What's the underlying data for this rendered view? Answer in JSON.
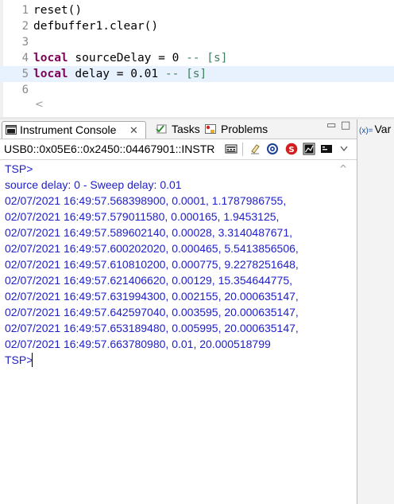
{
  "editor": {
    "lines": [
      {
        "num": "1",
        "parts": [
          {
            "t": "reset()",
            "c": "plain"
          }
        ]
      },
      {
        "num": "2",
        "parts": [
          {
            "t": "defbuffer1.clear()",
            "c": "plain"
          }
        ]
      },
      {
        "num": "3",
        "parts": []
      },
      {
        "num": "4",
        "parts": [
          {
            "t": "local",
            "c": "kw"
          },
          {
            "t": " sourceDelay = 0 ",
            "c": "plain"
          },
          {
            "t": "-- [s]",
            "c": "cm"
          }
        ]
      },
      {
        "num": "5",
        "parts": [
          {
            "t": "local",
            "c": "kw"
          },
          {
            "t": " delay = 0.01 ",
            "c": "plain"
          },
          {
            "t": "-- [s]",
            "c": "cm"
          }
        ]
      },
      {
        "num": "6",
        "parts": []
      }
    ],
    "current_line": 5,
    "scroll_left_glyph": "<"
  },
  "tabs": {
    "console_label": "Instrument Console",
    "close_glyph": "✕",
    "tasks_label": "Tasks",
    "problems_label": "Problems",
    "minimize_glyph": "▭",
    "maximize_glyph": "□",
    "variables_label": "Var",
    "variables_prefix": "(x)="
  },
  "toolbar": {
    "connection": "USB0::0x05E6::0x2450::04467901::INSTR",
    "icons": [
      "keypad-icon",
      "eraser-icon",
      "target-icon",
      "stop-icon",
      "chart-icon",
      "terminal-icon",
      "view-menu-icon"
    ]
  },
  "console": {
    "lines": [
      "TSP>",
      "source delay: 0 - Sweep delay: 0.01",
      "02/07/2021 16:49:57.568398900, 0.0001, 1.1787986755,",
      "02/07/2021 16:49:57.579011580, 0.000165, 1.9453125,",
      "02/07/2021 16:49:57.589602140, 0.00028, 3.3140487671,",
      "02/07/2021 16:49:57.600202020, 0.000465, 5.5413856506,",
      "02/07/2021 16:49:57.610810200, 0.000775, 9.2278251648,",
      "02/07/2021 16:49:57.621406620, 0.00129, 15.354644775,",
      "02/07/2021 16:49:57.631994300, 0.002155, 20.000635147,",
      "02/07/2021 16:49:57.642597040, 0.003595, 20.000635147,",
      "02/07/2021 16:49:57.653189480, 0.005995, 20.000635147,",
      "02/07/2021 16:49:57.663780980, 0.01, 20.000518799",
      "TSP>"
    ],
    "scroll_up_glyph": "^"
  },
  "colors": {
    "keyword": "#7f0055",
    "comment": "#3f7f5f",
    "console_text": "#2020c8",
    "current_line": "#e8f2fe"
  }
}
